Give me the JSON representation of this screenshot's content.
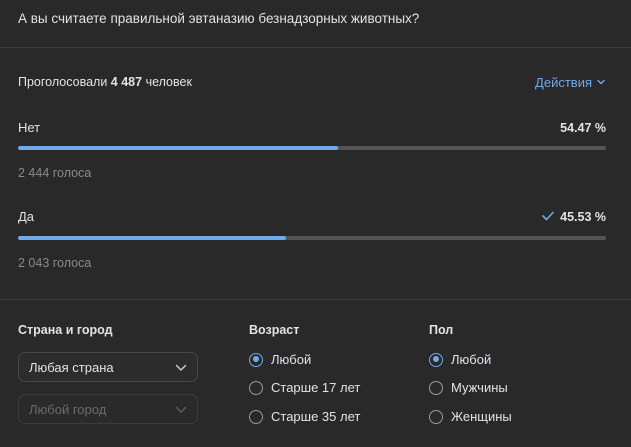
{
  "poll": {
    "question": "А вы считаете правильной эвтаназию безнадзорных животных?",
    "voted_prefix": "Проголосовали",
    "voted_count": "4 487",
    "voted_suffix": "человек",
    "actions_label": "Действия"
  },
  "options": [
    {
      "label": "Нет",
      "percent_text": "54.47 %",
      "percent": 54.47,
      "votes_text": "2 444 голоса",
      "selected": false
    },
    {
      "label": "Да",
      "percent_text": "45.53 %",
      "percent": 45.53,
      "votes_text": "2 043 голоса",
      "selected": true
    }
  ],
  "filters": {
    "location": {
      "heading": "Страна и город",
      "country_value": "Любая страна",
      "city_value": "Любой город"
    },
    "age": {
      "heading": "Возраст",
      "options": [
        "Любой",
        "Старше 17 лет",
        "Старше 35 лет"
      ],
      "selected_index": 0
    },
    "sex": {
      "heading": "Пол",
      "options": [
        "Любой",
        "Мужчины",
        "Женщины"
      ],
      "selected_index": 0
    }
  },
  "colors": {
    "accent": "#71aaeb",
    "background": "#292929",
    "bar_track": "#555555"
  }
}
